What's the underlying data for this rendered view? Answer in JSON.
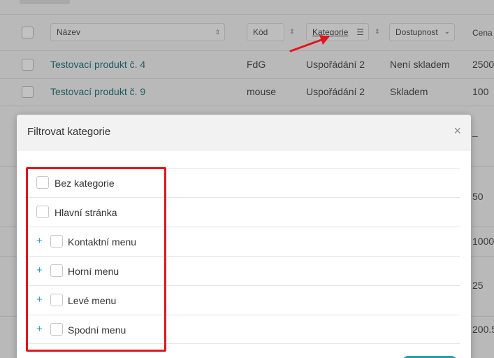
{
  "table": {
    "filters": {
      "name_placeholder": "Název",
      "code_placeholder": "Kód",
      "category_label": "Kategorie",
      "availability_label": "Dostupnost",
      "price_header": "Cena"
    },
    "rows": [
      {
        "name": "Testovací produkt č. 4",
        "code": "FdG",
        "category": "Uspořádání 2",
        "availability": "Není skladem",
        "price": "2500"
      },
      {
        "name": "Testovací produkt č. 9",
        "code": "mouse",
        "category": "Uspořádání 2",
        "availability": "Skladem",
        "price": "100"
      }
    ],
    "side_values": [
      "–",
      "50",
      "1000",
      "25",
      "200.5"
    ]
  },
  "modal": {
    "title": "Filtrovat kategorie",
    "close_glyph": "×",
    "categories": [
      {
        "label": "Bez kategorie",
        "expandable": false
      },
      {
        "label": "Hlavní stránka",
        "expandable": false
      },
      {
        "label": "Kontaktní menu",
        "expandable": true
      },
      {
        "label": "Horní menu",
        "expandable": true
      },
      {
        "label": "Levé menu",
        "expandable": true
      },
      {
        "label": "Spodní menu",
        "expandable": true
      }
    ],
    "expand_glyph": "+"
  },
  "colors": {
    "accent": "#2c9aa6",
    "annotation_red": "#e0161f"
  }
}
